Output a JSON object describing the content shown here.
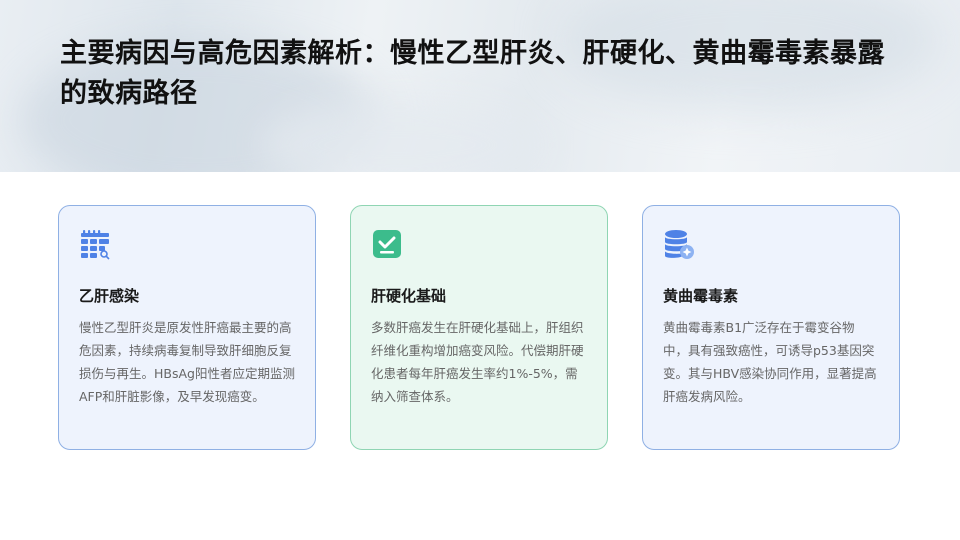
{
  "slide": {
    "title": "主要病因与高危因素解析：慢性乙型肝炎、肝硬化、黄曲霉毒素暴露的致病路径"
  },
  "cards": [
    {
      "icon": "calendar-icon",
      "title": "乙肝感染",
      "text": "慢性乙型肝炎是原发性肝癌最主要的高危因素，持续病毒复制导致肝细胞反复损伤与再生。HBsAg阳性者应定期监测AFP和肝脏影像，及早发现癌变。"
    },
    {
      "icon": "check-square-icon",
      "title": "肝硬化基础",
      "text": "多数肝癌发生在肝硬化基础上，肝组织纤维化重构增加癌变风险。代偿期肝硬化患者每年肝癌发生率约1%-5%，需纳入筛查体系。"
    },
    {
      "icon": "database-icon",
      "title": "黄曲霉毒素",
      "text": "黄曲霉毒素B1广泛存在于霉变谷物中，具有强致癌性，可诱导p53基因突变。其与HBV感染协同作用，显著提高肝癌发病风险。"
    }
  ],
  "colors": {
    "blue_card_bg": "#eef3fd",
    "blue_card_border": "#8fb0e4",
    "green_card_bg": "#eaf8f1",
    "green_card_border": "#8fd5b3",
    "blue_icon": "#4f82e6",
    "green_icon": "#3cbc8c"
  }
}
